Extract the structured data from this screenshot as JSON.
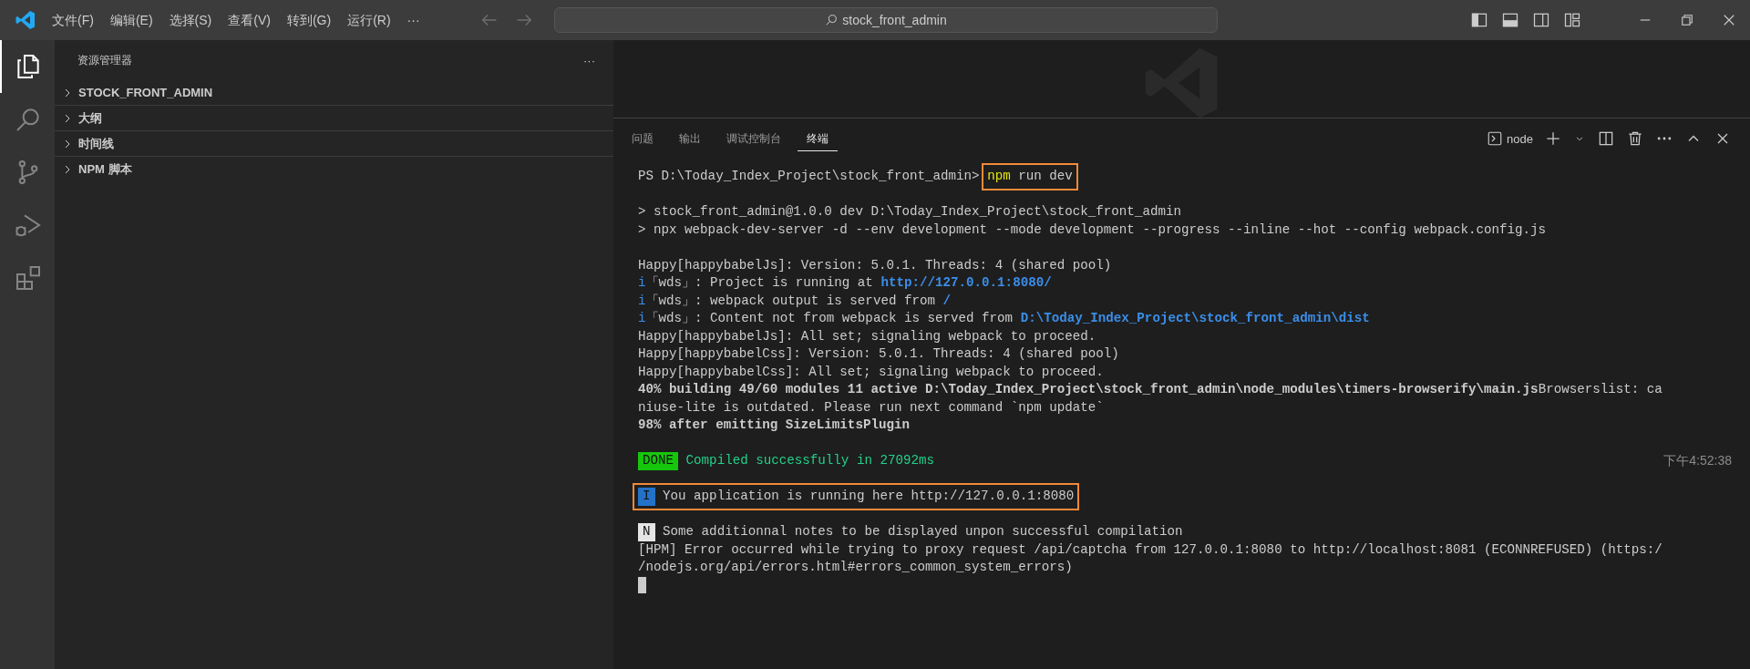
{
  "titlebar": {
    "menus": [
      "文件(F)",
      "编辑(E)",
      "选择(S)",
      "查看(V)",
      "转到(G)",
      "运行(R)"
    ],
    "more": "···",
    "nav": [
      {
        "kind": "back",
        "disabled": true
      },
      {
        "kind": "forward",
        "disabled": true
      }
    ],
    "search": {
      "value": "stock_front_admin"
    }
  },
  "activitybar": {
    "items": [
      {
        "kind": "explorer",
        "selected": true
      },
      {
        "kind": "search",
        "selected": false
      },
      {
        "kind": "scm",
        "selected": false
      },
      {
        "kind": "debug",
        "selected": false
      },
      {
        "kind": "extensions",
        "selected": false
      }
    ]
  },
  "sidebar": {
    "title": "资源管理器",
    "more": "···",
    "sections": [
      {
        "label": "STOCK_FRONT_ADMIN",
        "expanded": false
      },
      {
        "label": "大纲",
        "expanded": false
      },
      {
        "label": "时间线",
        "expanded": false
      },
      {
        "label": "NPM 脚本",
        "expanded": false
      }
    ]
  },
  "panel": {
    "tabs": [
      {
        "label": "问题",
        "selected": false
      },
      {
        "label": "输出",
        "selected": false
      },
      {
        "label": "调试控制台",
        "selected": false
      },
      {
        "label": "终端",
        "selected": true
      }
    ],
    "terminal_name": "node",
    "terminal": {
      "blocks": [
        {
          "lines": [
            {
              "segments": [
                {
                  "kind": "plain",
                  "text": "PS D:\\Today_Index_Project\\stock_front_admin> "
                },
                {
                  "kind": "outlined",
                  "segments": [
                    {
                      "kind": "keyword",
                      "text": "npm"
                    },
                    {
                      "kind": "plain",
                      "text": " run dev"
                    }
                  ]
                }
              ]
            }
          ]
        },
        {
          "lines": [
            {
              "segments": [
                {
                  "kind": "plain",
                  "text": "> stock_front_admin@1.0.0 dev D:\\Today_Index_Project\\stock_front_admin"
                }
              ]
            },
            {
              "segments": [
                {
                  "kind": "plain",
                  "text": "> npx webpack-dev-server -d --env development --mode development --progress --inline --hot --config webpack.config.js"
                }
              ]
            }
          ]
        },
        {
          "lines": [
            {
              "segments": [
                {
                  "kind": "plain",
                  "text": "Happy[happybabelJs]: Version: 5.0.1. Threads: 4 (shared pool)"
                }
              ]
            },
            {
              "segments": [
                {
                  "kind": "info",
                  "text": "i"
                },
                {
                  "kind": "plain",
                  "text": "「wds」: Project is running at "
                },
                {
                  "kind": "link",
                  "text": "http://127.0.0.1:8080/"
                }
              ]
            },
            {
              "segments": [
                {
                  "kind": "info",
                  "text": "i"
                },
                {
                  "kind": "plain",
                  "text": "「wds」: webpack output is served from "
                },
                {
                  "kind": "link",
                  "text": "/"
                }
              ]
            },
            {
              "segments": [
                {
                  "kind": "info",
                  "text": "i"
                },
                {
                  "kind": "plain",
                  "text": "「wds」: Content not from webpack is served from "
                },
                {
                  "kind": "link",
                  "text": "D:\\Today_Index_Project\\stock_front_admin\\dist"
                }
              ]
            },
            {
              "segments": [
                {
                  "kind": "plain",
                  "text": "Happy[happybabelJs]: All set; signaling webpack to proceed."
                }
              ]
            },
            {
              "segments": [
                {
                  "kind": "plain",
                  "text": "Happy[happybabelCss]: Version: 5.0.1. Threads: 4 (shared pool)"
                }
              ]
            },
            {
              "segments": [
                {
                  "kind": "plain",
                  "text": "Happy[happybabelCss]: All set; signaling webpack to proceed."
                }
              ]
            },
            {
              "segments": [
                {
                  "kind": "bold",
                  "text": "40% building 49/60 modules 11 active D:\\Today_Index_Project\\stock_front_admin\\node_modules\\timers-browserify\\main.js"
                },
                {
                  "kind": "plain",
                  "text": "Browserslist: ca"
                }
              ]
            },
            {
              "segments": [
                {
                  "kind": "plain",
                  "text": "niuse-lite is outdated. Please run next command `npm update`"
                }
              ]
            },
            {
              "segments": [
                {
                  "kind": "bold",
                  "text": "98% after emitting SizeLimitsPlugin"
                }
              ]
            }
          ]
        },
        {
          "lines": [
            {
              "segments": [
                {
                  "kind": "badge",
                  "text": "DONE",
                  "color": "#16c60c"
                },
                {
                  "kind": "success",
                  "text": " Compiled successfully in 27092ms"
                }
              ],
              "timestamp": "下午4:52:38"
            }
          ]
        },
        {
          "lines": [
            {
              "segments": [
                {
                  "kind": "outlined",
                  "segments": [
                    {
                      "kind": "badge",
                      "text": "I",
                      "color": "#2472c8"
                    },
                    {
                      "kind": "plain",
                      "text": " You application is running here http://127.0.0.1:8080"
                    }
                  ]
                }
              ]
            }
          ]
        },
        {
          "lines": [
            {
              "segments": [
                {
                  "kind": "badge",
                  "text": "N",
                  "color": "#e5e5e5"
                },
                {
                  "kind": "plain",
                  "text": " Some additionnal notes to be displayed unpon successful compilation"
                }
              ]
            },
            {
              "segments": [
                {
                  "kind": "plain",
                  "text": "[HPM] Error occurred while trying to proxy request /api/captcha from 127.0.0.1:8080 to http://localhost:8081 (ECONNREFUSED) (https:/"
                }
              ]
            },
            {
              "segments": [
                {
                  "kind": "plain",
                  "text": "/nodejs.org/api/errors.html#errors_common_system_errors)"
                }
              ]
            },
            {
              "segments": [
                {
                  "kind": "cursor"
                }
              ]
            }
          ]
        }
      ]
    }
  }
}
